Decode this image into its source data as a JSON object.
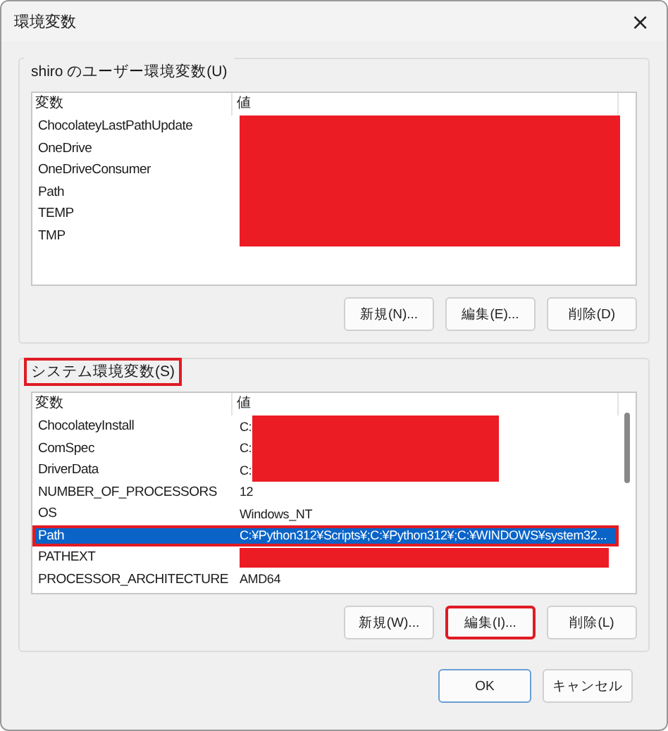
{
  "window": {
    "title": "環境変数",
    "close": "×"
  },
  "user_group": {
    "label": "shiro のユーザー環境変数(U)",
    "highlighted": false,
    "columns": [
      "変数",
      "値"
    ],
    "rows": [
      {
        "name": "ChocolateyLastPathUpdate",
        "value": "",
        "redacted": true,
        "selected": false
      },
      {
        "name": "OneDrive",
        "value": "",
        "redacted": true,
        "selected": false
      },
      {
        "name": "OneDriveConsumer",
        "value": "",
        "redacted": true,
        "selected": false
      },
      {
        "name": "Path",
        "value": "",
        "redacted": true,
        "selected": false
      },
      {
        "name": "TEMP",
        "value": "",
        "redacted": true,
        "selected": false
      },
      {
        "name": "TMP",
        "value": "",
        "redacted": true,
        "selected": false
      }
    ],
    "buttons": [
      {
        "label": "新規(N)...",
        "highlighted": false
      },
      {
        "label": "編集(E)...",
        "highlighted": false
      },
      {
        "label": "削除(D)",
        "highlighted": false
      }
    ]
  },
  "system_group": {
    "label": "システム環境変数(S)",
    "highlighted": true,
    "columns": [
      "変数",
      "値"
    ],
    "rows": [
      {
        "name": "ChocolateyInstall",
        "value": "C:",
        "redacted": true,
        "selected": false
      },
      {
        "name": "ComSpec",
        "value": "C:",
        "redacted": true,
        "selected": false
      },
      {
        "name": "DriverData",
        "value": "C:",
        "redacted": true,
        "selected": false
      },
      {
        "name": "NUMBER_OF_PROCESSORS",
        "value": "12",
        "redacted": false,
        "selected": false
      },
      {
        "name": "OS",
        "value": "Windows_NT",
        "redacted": false,
        "selected": false
      },
      {
        "name": "Path",
        "value": "C:¥Python312¥Scripts¥;C:¥Python312¥;C:¥WINDOWS¥system32...",
        "redacted": false,
        "selected": true
      },
      {
        "name": "PATHEXT",
        "value": "",
        "redacted": true,
        "selected": false
      },
      {
        "name": "PROCESSOR_ARCHITECTURE",
        "value": "AMD64",
        "redacted": false,
        "selected": false
      }
    ],
    "buttons": [
      {
        "label": "新規(W)...",
        "highlighted": false
      },
      {
        "label": "編集(I)...",
        "highlighted": true
      },
      {
        "label": "削除(L)",
        "highlighted": false
      }
    ]
  },
  "footer_buttons": [
    {
      "label": "OK",
      "default": true
    },
    {
      "label": "キャンセル",
      "default": false
    }
  ]
}
